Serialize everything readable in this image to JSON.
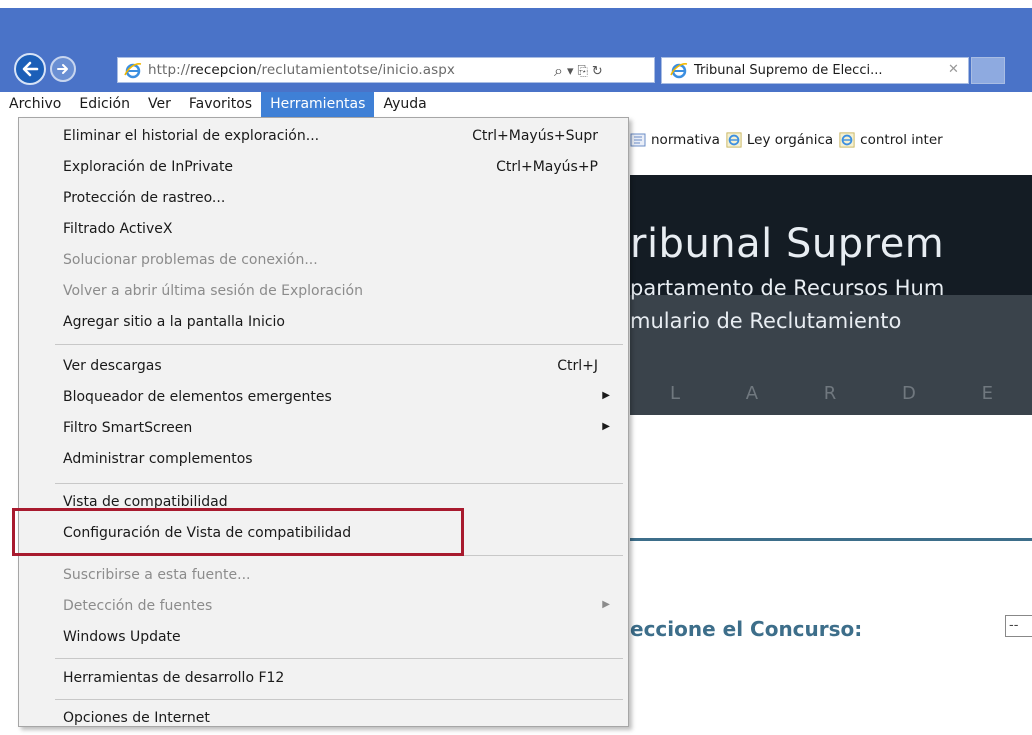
{
  "address_bar": {
    "url_prefix": "http://",
    "url_host": "recepcion",
    "url_path": "/reclutamientotse/inicio.aspx",
    "search_glyph": "⌕",
    "dropdown_glyph": "▾",
    "compat_glyph": "⎘",
    "refresh_glyph": "↻"
  },
  "tab": {
    "title": "Tribunal Supremo de Elecci...",
    "close": "✕"
  },
  "menubar": {
    "items": [
      "Archivo",
      "Edición",
      "Ver",
      "Favoritos",
      "Herramientas",
      "Ayuda"
    ]
  },
  "favorites": {
    "items": [
      "normativa",
      "Ley orgánica",
      "control inter"
    ]
  },
  "banner": {
    "title": "ribunal Suprem",
    "subtitle1": "partamento de Recursos Hum",
    "subtitle2": "mulario de Reclutamiento",
    "letters": "L A R D E"
  },
  "form": {
    "concurso_label": "eccione el Concurso:",
    "concurso_value": "--"
  },
  "tools_menu": {
    "items": [
      {
        "label": "Eliminar el historial de exploración...",
        "shortcut": "Ctrl+Mayús+Supr",
        "disabled": false
      },
      {
        "label": "Exploración de InPrivate",
        "shortcut": "Ctrl+Mayús+P",
        "disabled": false
      },
      {
        "label": "Protección de rastreo...",
        "shortcut": "",
        "disabled": false
      },
      {
        "label": "Filtrado ActiveX",
        "shortcut": "",
        "disabled": false
      },
      {
        "label": "Solucionar problemas de conexión...",
        "shortcut": "",
        "disabled": true
      },
      {
        "label": "Volver a abrir última sesión de Exploración",
        "shortcut": "",
        "disabled": true
      },
      {
        "label": "Agregar sitio a la pantalla Inicio",
        "shortcut": "",
        "disabled": false
      },
      {
        "label": "Ver descargas",
        "shortcut": "Ctrl+J",
        "disabled": false
      },
      {
        "label": "Bloqueador de elementos emergentes",
        "shortcut": "",
        "disabled": false,
        "submenu": true
      },
      {
        "label": "Filtro SmartScreen",
        "shortcut": "",
        "disabled": false,
        "submenu": true
      },
      {
        "label": "Administrar complementos",
        "shortcut": "",
        "disabled": false
      },
      {
        "label": "Vista de compatibilidad",
        "shortcut": "",
        "disabled": false
      },
      {
        "label": "Configuración de Vista de compatibilidad",
        "shortcut": "",
        "disabled": false,
        "highlighted": true
      },
      {
        "label": "Suscribirse a esta fuente...",
        "shortcut": "",
        "disabled": true
      },
      {
        "label": "Detección de fuentes",
        "shortcut": "",
        "disabled": true,
        "submenu": true
      },
      {
        "label": "Windows Update",
        "shortcut": "",
        "disabled": false
      },
      {
        "label": "Herramientas de desarrollo F12",
        "shortcut": "",
        "disabled": false
      },
      {
        "label": "Opciones de Internet",
        "shortcut": "",
        "disabled": false
      }
    ]
  },
  "colors": {
    "titlebar": "#4a73c8",
    "menu_active": "#3f80d6",
    "highlight_box": "#a81a2e",
    "banner_bg": "#141c24",
    "accent_text": "#3d6e8a"
  }
}
